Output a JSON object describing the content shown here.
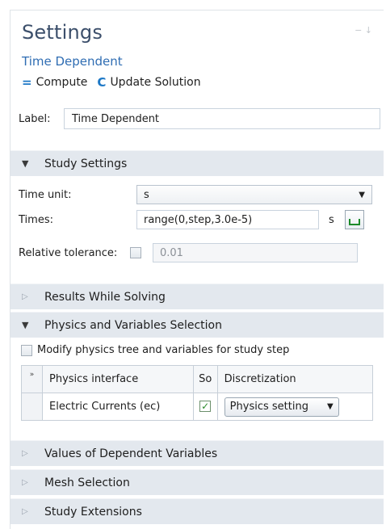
{
  "header": {
    "title": "Settings",
    "window_controls": "− ↓",
    "subtitle": "Time Dependent"
  },
  "toolbar": {
    "compute_icon": "=",
    "compute_label": "Compute",
    "update_icon": "C",
    "update_label": "Update Solution"
  },
  "label_field": {
    "label": "Label:",
    "value": "Time Dependent"
  },
  "sections": {
    "study_settings": "Study Settings",
    "results_while_solving": "Results While Solving",
    "physics_variables": "Physics and Variables Selection",
    "values_dependent": "Values of Dependent Variables",
    "mesh_selection": "Mesh Selection",
    "study_extensions": "Study Extensions"
  },
  "study_settings": {
    "time_unit_label": "Time unit:",
    "time_unit_value": "s",
    "times_label": "Times:",
    "times_value": "range(0,step,3.0e-5)",
    "times_unit": "s",
    "rel_tol_label": "Relative tolerance:",
    "rel_tol_value": "0.01",
    "rel_tol_checked": false
  },
  "physics_selection": {
    "modify_label": "Modify physics tree and variables for study step",
    "modify_checked": false,
    "table": {
      "gutter_header": "»",
      "headers": [
        "Physics interface",
        "So",
        "Discretization"
      ],
      "rows": [
        {
          "interface": "Electric Currents (ec)",
          "solve": true,
          "discretization": "Physics setting"
        }
      ]
    }
  },
  "icons": {
    "section_open": "triangle-down-icon",
    "section_closed": "triangle-right-icon",
    "range": "range-icon"
  },
  "colors": {
    "title": "#3c4f6b",
    "subtitle": "#2f6db3",
    "section_bg": "#e3e8ee",
    "accent_icon": "#1d78c6",
    "check_green": "#2a8a2a"
  }
}
